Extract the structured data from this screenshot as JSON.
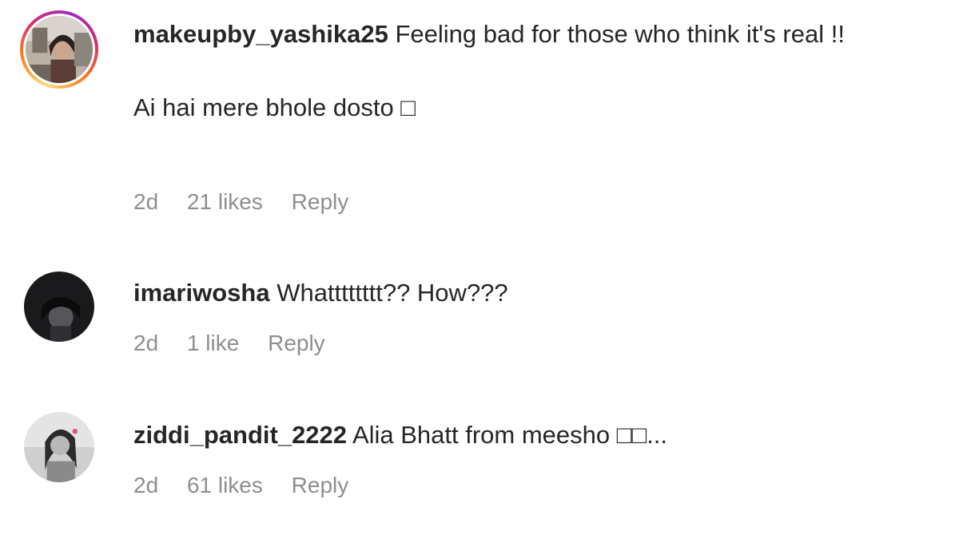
{
  "comments": [
    {
      "username": "makeupby_yashika25",
      "text": "Feeling bad for those who think it's real !!",
      "extra_text": "Ai hai mere bhole dosto □",
      "time": "2d",
      "likes": "21 likes",
      "reply_label": "Reply",
      "avatar_icon": "profile-avatar-with-story-ring"
    },
    {
      "username": "imariwosha",
      "text": "Whatttttttt?? How???",
      "time": "2d",
      "likes": "1 like",
      "reply_label": "Reply",
      "avatar_icon": "profile-avatar"
    },
    {
      "username": "ziddi_pandit_2222",
      "text": "Alia Bhatt from meesho □□...",
      "time": "2d",
      "likes": "61 likes",
      "reply_label": "Reply",
      "avatar_icon": "profile-avatar"
    }
  ],
  "colors": {
    "text_primary": "#262626",
    "text_secondary": "#8e8e8e",
    "story_ring": "#d62976"
  }
}
